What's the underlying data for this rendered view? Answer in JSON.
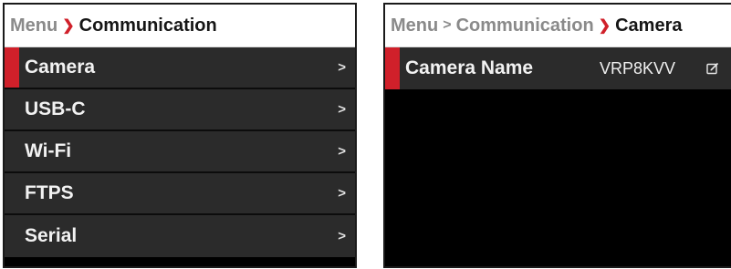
{
  "left_panel": {
    "breadcrumb": {
      "root": "Menu",
      "current": "Communication"
    },
    "items": [
      {
        "label": "Camera",
        "chevron": ">",
        "selected": true
      },
      {
        "label": "USB-C",
        "chevron": ">"
      },
      {
        "label": "Wi-Fi",
        "chevron": ">"
      },
      {
        "label": "FTPS",
        "chevron": ">"
      },
      {
        "label": "Serial",
        "chevron": ">"
      }
    ]
  },
  "right_panel": {
    "breadcrumb": {
      "root": "Menu",
      "middle": "Communication",
      "current": "Camera"
    },
    "setting": {
      "label": "Camera Name",
      "value": "VRP8KVV",
      "icon": "edit-icon"
    }
  },
  "colors": {
    "accent": "#d0202a",
    "row_bg": "#2b2b2b",
    "panel_bg": "#000000"
  }
}
